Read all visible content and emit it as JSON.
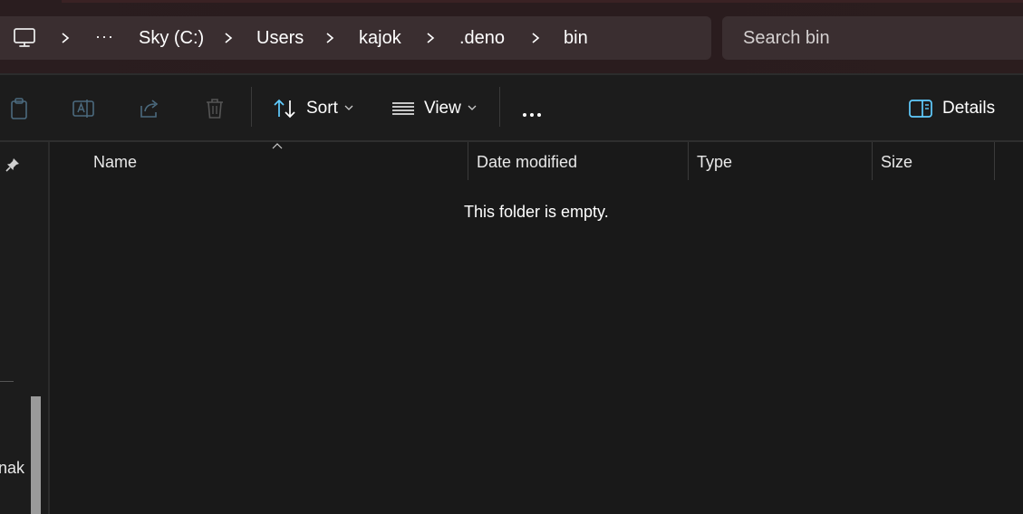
{
  "breadcrumb": {
    "items": [
      "Sky (C:)",
      "Users",
      "kajok",
      ".deno",
      "bin"
    ],
    "overflow": "···"
  },
  "search": {
    "placeholder": "Search bin"
  },
  "toolbar": {
    "sort_label": "Sort",
    "view_label": "View",
    "details_label": "Details"
  },
  "columns": {
    "name": "Name",
    "date_modified": "Date modified",
    "type": "Type",
    "size": "Size"
  },
  "content": {
    "empty_message": "This folder is empty."
  },
  "nav": {
    "truncated_item": "nak"
  },
  "colors": {
    "accent": "#60cdff",
    "background": "#191919",
    "address_bar": "#3a2e30"
  }
}
